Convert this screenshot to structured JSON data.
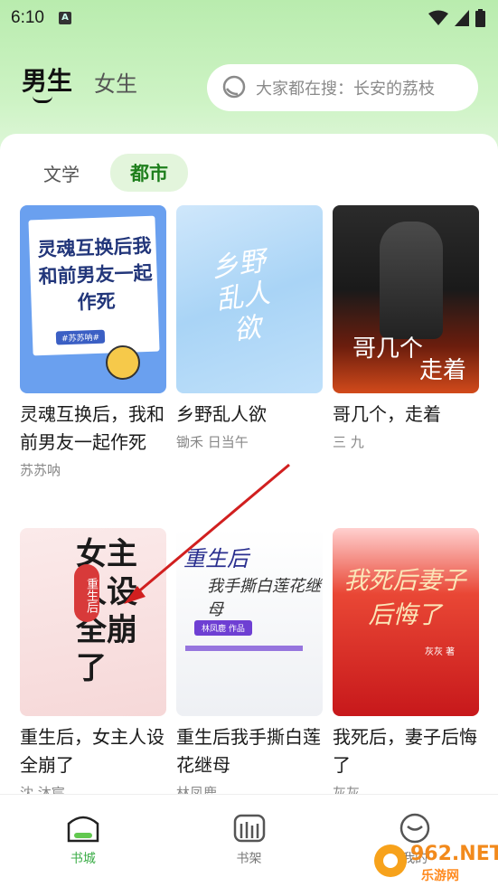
{
  "status_bar": {
    "time": "6:10",
    "notification_glyph": "A"
  },
  "header": {
    "gender_tabs": [
      {
        "label": "男生",
        "active": true
      },
      {
        "label": "女生",
        "active": false
      }
    ],
    "search": {
      "placeholder": "大家都在搜：长安的荔枝"
    }
  },
  "categories": [
    {
      "label": "文学",
      "active": false
    },
    {
      "label": "都市",
      "active": true
    }
  ],
  "books": [
    {
      "title": "灵魂互换后，我和前男友一起作死",
      "author": "苏苏呐",
      "cover_text": "灵魂互换后我和前男友一起作死",
      "cover_author": "#苏苏呐#"
    },
    {
      "title": "乡野乱人欲",
      "author": "锄禾 日当午",
      "cover_text": "乡野乱人欲"
    },
    {
      "title": "哥几个，走着",
      "author": "三 九",
      "cover_text": "哥几个",
      "cover_text2": "走着"
    },
    {
      "title": "重生后，女主人设全崩了",
      "author": "沈 沐宸",
      "cover_text": "女主人设全崩了",
      "cover_badge": "重生后"
    },
    {
      "title": "重生后我手撕白莲花继母",
      "author": "林凤鹿",
      "cover_text": "重生后",
      "cover_text2": "我手撕白莲花继母",
      "cover_tag": "林凤鹿 作品"
    },
    {
      "title": "我死后，妻子后悔了",
      "author": "灰灰",
      "cover_text": "我死后妻子后悔了",
      "cover_author": "灰灰 著"
    }
  ],
  "bottom_nav": [
    {
      "label": "书城",
      "icon": "bookstore-icon",
      "active": true
    },
    {
      "label": "书架",
      "icon": "bookshelf-icon",
      "active": false
    },
    {
      "label": "我的",
      "icon": "profile-icon",
      "active": false
    }
  ],
  "watermark": {
    "text": "962.NET",
    "subtext": "乐游网"
  },
  "colors": {
    "accent": "#3cad48",
    "tab_active_bg": "#e3f5dc",
    "header_bg": "#b9ecae",
    "annotation": "#d11f1f"
  }
}
